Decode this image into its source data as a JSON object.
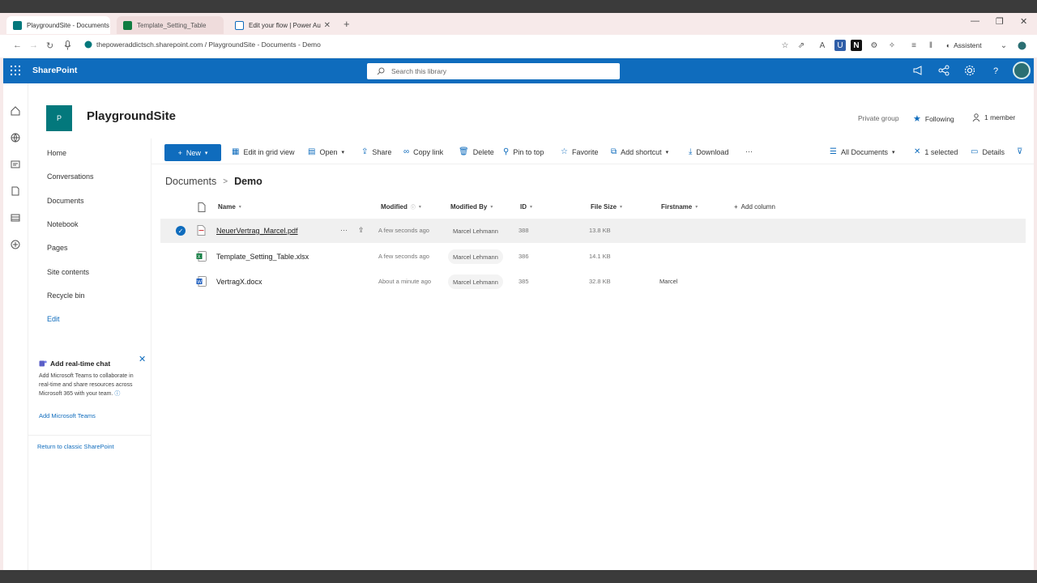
{
  "browser": {
    "tabs": [
      {
        "title": "PlaygroundSite - Documents",
        "active": true
      },
      {
        "title": "Template_Setting_Table",
        "active": false
      },
      {
        "title": "Edit your flow | Power Au",
        "active": false
      }
    ],
    "new_tab_glyph": "+",
    "url": "thepoweraddictsch.sharepoint.com / PlaygroundSite - Documents - Demo",
    "assistant_label": "Assistent"
  },
  "suite": {
    "app_name": "SharePoint",
    "search_placeholder": "Search this library"
  },
  "site": {
    "logo_letter": "P",
    "name": "PlaygroundSite",
    "privacy": "Private group",
    "following_label": "Following",
    "members_label": "1 member"
  },
  "nav": {
    "items": [
      "Home",
      "Conversations",
      "Documents",
      "Notebook",
      "Pages",
      "Site contents",
      "Recycle bin"
    ],
    "edit_label": "Edit"
  },
  "chat_card": {
    "title": "Add real-time chat",
    "body": "Add Microsoft Teams to collaborate in real-time and share resources across Microsoft 365 with your team.",
    "link": "Add Microsoft Teams"
  },
  "classic_link": "Return to classic SharePoint",
  "commands": {
    "new": "New",
    "edit_grid": "Edit in grid view",
    "open": "Open",
    "share": "Share",
    "copy_link": "Copy link",
    "delete": "Delete",
    "pin_top": "Pin to top",
    "favorite": "Favorite",
    "add_shortcut": "Add shortcut",
    "download": "Download",
    "more": "···",
    "view": "All Documents",
    "selected": "1 selected",
    "details": "Details"
  },
  "breadcrumb": {
    "root": "Documents",
    "separator": ">",
    "current": "Demo"
  },
  "list": {
    "columns": {
      "name": "Name",
      "modified": "Modified",
      "modified_by": "Modified By",
      "id": "ID",
      "file_size": "File Size",
      "firstname": "Firstname",
      "add_column": "Add column"
    },
    "rows": [
      {
        "name": "NeuerVertrag_Marcel.pdf",
        "type": "pdf",
        "modified": "A few seconds ago",
        "modified_by": "Marcel Lehmann",
        "id": "388",
        "size": "13.8 KB",
        "firstname": "",
        "selected": true
      },
      {
        "name": "Template_Setting_Table.xlsx",
        "type": "xlsx",
        "modified": "A few seconds ago",
        "modified_by": "Marcel Lehmann",
        "id": "386",
        "size": "14.1 KB",
        "firstname": "",
        "selected": false
      },
      {
        "name": "VertragX.docx",
        "type": "docx",
        "modified": "About a minute ago",
        "modified_by": "Marcel Lehmann",
        "id": "385",
        "size": "32.8 KB",
        "firstname": "Marcel",
        "selected": false
      }
    ]
  },
  "colors": {
    "brand": "#0f6cbd",
    "site_logo": "#03787c",
    "pdf": "#d13438",
    "xlsx": "#107c41",
    "docx": "#185abd"
  }
}
